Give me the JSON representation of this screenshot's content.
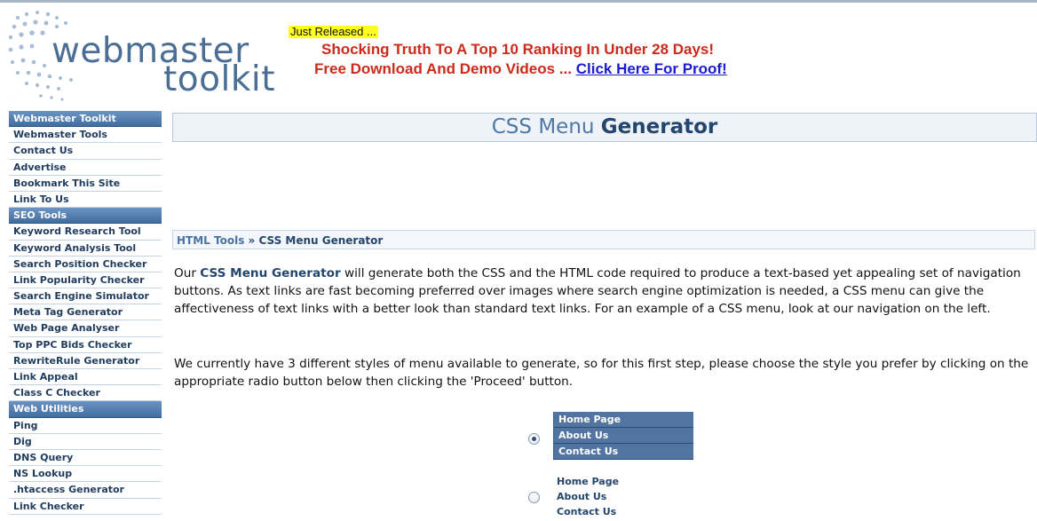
{
  "logo": {
    "word1": "webmaster",
    "word2": "toolkit"
  },
  "promo": {
    "tag": "Just Released ...",
    "line1": "Shocking Truth To A Top 10 Ranking In Under 28 Days!",
    "line2_prefix": "Free Download And Demo Videos ... ",
    "line2_link": "Click Here For Proof!"
  },
  "sidebar": {
    "items": [
      {
        "label": "Webmaster Toolkit",
        "type": "header"
      },
      {
        "label": "Webmaster Tools",
        "type": "link"
      },
      {
        "label": "Contact Us",
        "type": "link"
      },
      {
        "label": "Advertise",
        "type": "link"
      },
      {
        "label": "Bookmark This Site",
        "type": "link"
      },
      {
        "label": "Link To Us",
        "type": "link"
      },
      {
        "label": "SEO Tools",
        "type": "header"
      },
      {
        "label": "Keyword Research Tool",
        "type": "link"
      },
      {
        "label": "Keyword Analysis Tool",
        "type": "link"
      },
      {
        "label": "Search Position Checker",
        "type": "link"
      },
      {
        "label": "Link Popularity Checker",
        "type": "link"
      },
      {
        "label": "Search Engine Simulator",
        "type": "link"
      },
      {
        "label": "Meta Tag Generator",
        "type": "link"
      },
      {
        "label": "Web Page Analyser",
        "type": "link"
      },
      {
        "label": "Top PPC Bids Checker",
        "type": "link"
      },
      {
        "label": "RewriteRule Generator",
        "type": "link"
      },
      {
        "label": "Link Appeal",
        "type": "link"
      },
      {
        "label": "Class C Checker",
        "type": "link"
      },
      {
        "label": "Web Utilities",
        "type": "header"
      },
      {
        "label": "Ping",
        "type": "link"
      },
      {
        "label": "Dig",
        "type": "link"
      },
      {
        "label": "DNS Query",
        "type": "link"
      },
      {
        "label": "NS Lookup",
        "type": "link"
      },
      {
        "label": ".htaccess Generator",
        "type": "link"
      },
      {
        "label": "Link Checker",
        "type": "link"
      }
    ]
  },
  "main": {
    "title_light": "CSS Menu ",
    "title_bold": "Generator",
    "breadcrumb": {
      "parent": "HTML Tools",
      "separator": " » ",
      "current": "CSS Menu Generator"
    },
    "para1": {
      "prefix": "Our ",
      "emphasis": "CSS Menu Generator",
      "rest": " will generate both the CSS and the HTML code required to produce a text-based yet appealing set of navigation buttons. As text links are fast becoming preferred over images where search engine optimization is needed, a CSS menu can give the affectiveness of text links with a better look than standard text links. For an example of a CSS menu, look at our navigation on the left."
    },
    "para2": "We currently have 3 different styles of menu available to generate, so for this first step, please choose the style you prefer by clicking on the appropriate radio button below then clicking the 'Proceed' button.",
    "styles": [
      {
        "selected": true,
        "items": [
          "Home Page",
          "About Us",
          "Contact Us"
        ]
      },
      {
        "selected": false,
        "items": [
          "Home Page",
          "About Us",
          "Contact Us"
        ]
      }
    ]
  },
  "colors": {
    "sidebar_header": "#4d79ad",
    "sidebar_text": "#1f3c5f",
    "title_text": "#4f78a6",
    "promo_red": "#cc2a1a",
    "promo_link": "#1b1bd0",
    "menu1_bg": "#5274a0"
  }
}
